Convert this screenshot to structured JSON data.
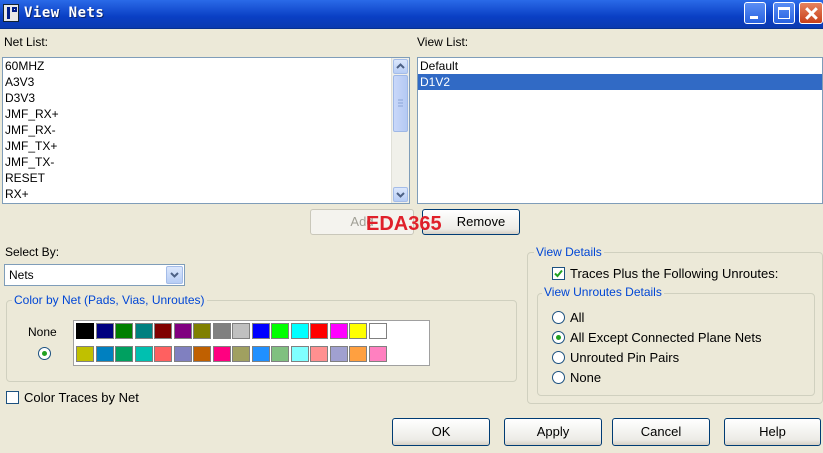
{
  "window": {
    "title": "View Nets"
  },
  "net_list": {
    "label": "Net List:",
    "items": [
      "60MHZ",
      "A3V3",
      "D3V3",
      "JMF_RX+",
      "JMF_RX-",
      "JMF_TX+",
      "JMF_TX-",
      "RESET",
      "RX+"
    ]
  },
  "view_list": {
    "label": "View List:",
    "items": [
      "Default",
      "D1V2"
    ],
    "selected": "D1V2"
  },
  "buttons": {
    "add": "Add",
    "remove": "Remove",
    "ok": "OK",
    "apply": "Apply",
    "cancel": "Cancel",
    "help": "Help"
  },
  "watermark": "EDA365",
  "select_by": {
    "label": "Select By:",
    "value": "Nets"
  },
  "color_by_net": {
    "title": "Color by Net (Pads, Vias, Unroutes)",
    "none_label": "None",
    "none_selected": true,
    "palette_row1": [
      "#000000",
      "#000080",
      "#008000",
      "#008080",
      "#800000",
      "#800080",
      "#808000",
      "#808080",
      "#c0c0c0",
      "#0000ff",
      "#00ff00",
      "#00ffff",
      "#ff0000",
      "#ff00ff",
      "#ffff00",
      "#ffffff"
    ],
    "palette_row2": [
      "#c0c000",
      "#0080c0",
      "#00a060",
      "#00c0b0",
      "#ff6060",
      "#8080c0",
      "#c06000",
      "#ff0080",
      "#a0a060",
      "#2090ff",
      "#80c080",
      "#80ffff",
      "#ff9090",
      "#a0a0d0",
      "#ffa040",
      "#ff80c0"
    ]
  },
  "color_traces": {
    "label": "Color Traces by Net",
    "checked": false
  },
  "view_details": {
    "title": "View Details",
    "traces_plus": {
      "label": "Traces Plus the Following Unroutes:",
      "checked": true
    },
    "unroutes": {
      "title": "View Unroutes Details",
      "options": [
        "All",
        "All Except Connected Plane Nets",
        "Unrouted Pin Pairs",
        "None"
      ],
      "selected": "All Except Connected Plane Nets"
    }
  }
}
